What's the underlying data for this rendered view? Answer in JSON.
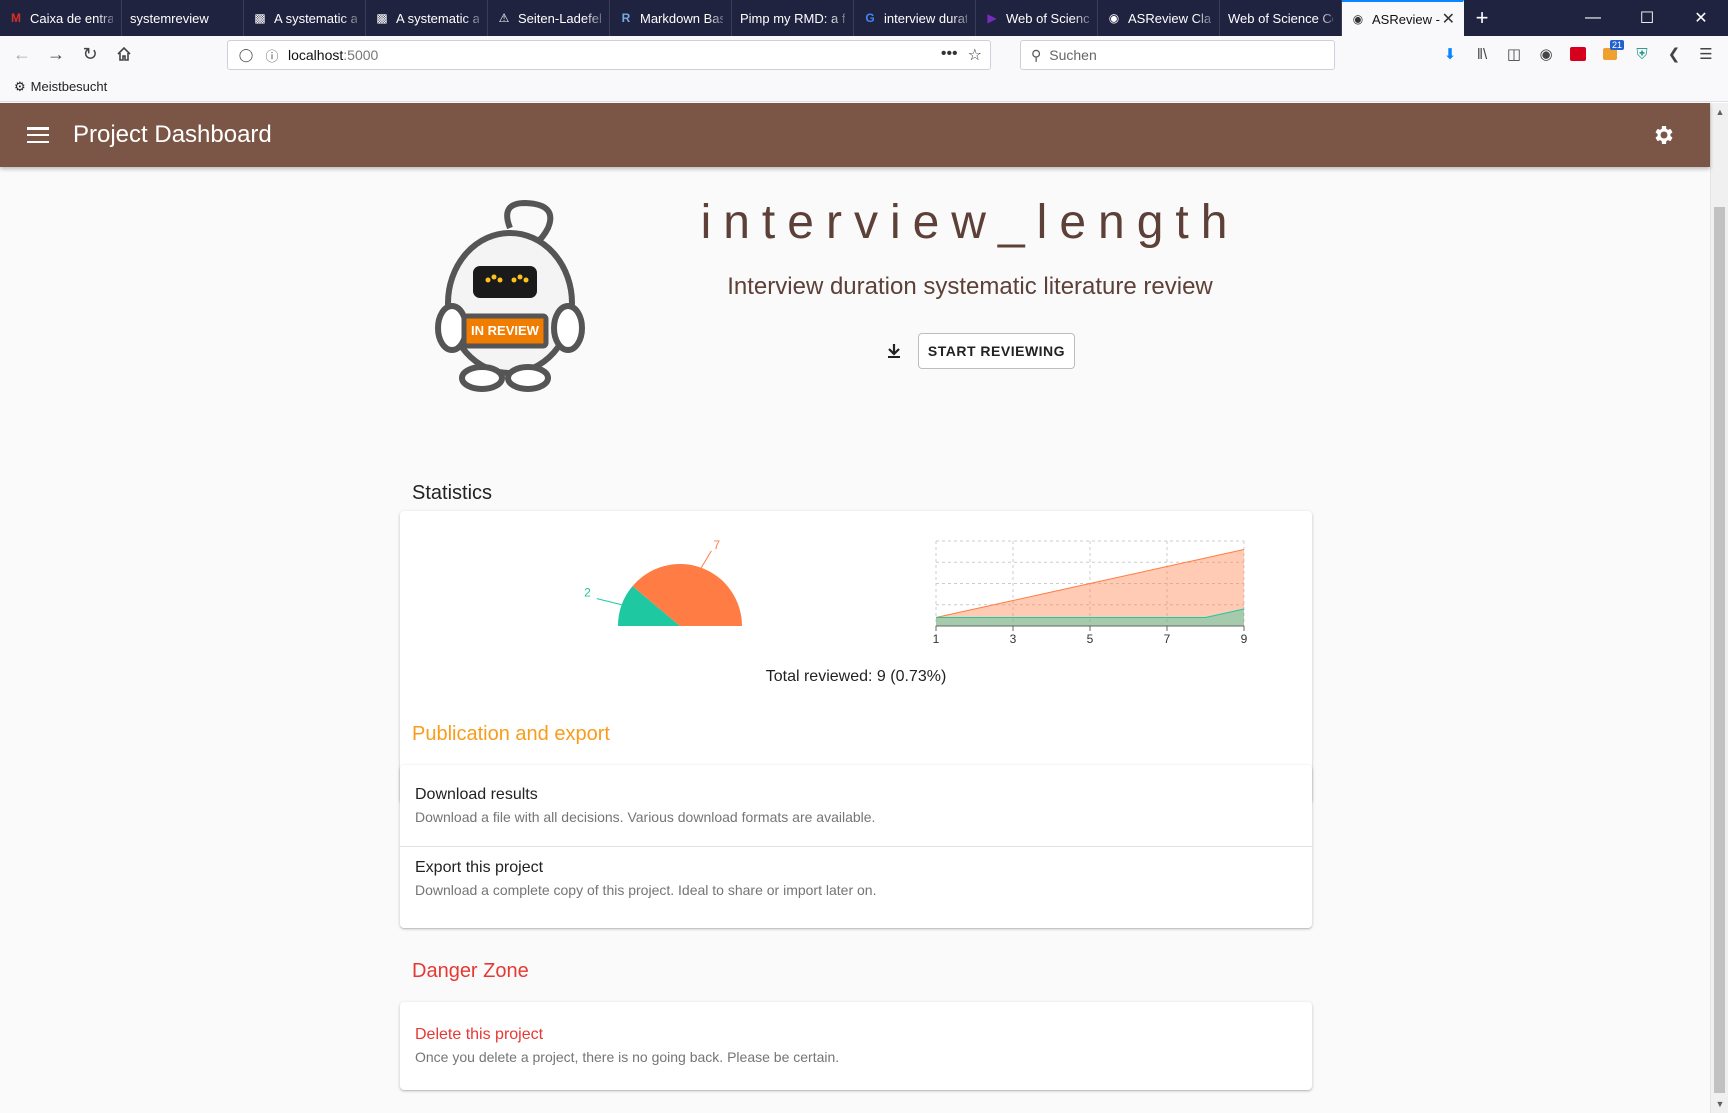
{
  "browser": {
    "tabs": [
      {
        "label": "Caixa de entrada",
        "icon": "gmail-icon",
        "icon_color": "#d93025"
      },
      {
        "label": "systemreview",
        "icon": "",
        "icon_color": ""
      },
      {
        "label": "A systematic approach",
        "icon": "page-icon",
        "icon_color": "#ffffff"
      },
      {
        "label": "A systematic approach",
        "icon": "page-icon",
        "icon_color": "#ffffff"
      },
      {
        "label": "Seiten-Ladefehler",
        "icon": "warning-icon",
        "icon_color": "#ffffff"
      },
      {
        "label": "Markdown Basics",
        "icon": "r-icon",
        "icon_color": "#75aadb"
      },
      {
        "label": "Pimp my RMD: a few tips",
        "icon": "",
        "icon_color": ""
      },
      {
        "label": "interview duration",
        "icon": "google-icon",
        "icon_color": "#4285f4"
      },
      {
        "label": "Web of Science",
        "icon": "play-icon",
        "icon_color": "#7b2cbf"
      },
      {
        "label": "ASReview Class",
        "icon": "asreview-icon",
        "icon_color": "#ffffff"
      },
      {
        "label": "Web of Science Core",
        "icon": "",
        "icon_color": ""
      },
      {
        "label": "ASReview -",
        "icon": "asreview-icon",
        "icon_color": "#333333",
        "active": true
      }
    ],
    "new_tab": "+",
    "url_host": "localhost",
    "url_port": ":5000",
    "search_placeholder": "Suchen",
    "bookmark_label": "Meistbesucht",
    "badge_count": "21"
  },
  "app": {
    "title": "Project Dashboard",
    "accent_color": "#7b5646"
  },
  "project": {
    "name": "interview_length",
    "description": "Interview duration systematic literature review",
    "status_badge": "IN REVIEW",
    "start_button": "START REVIEWING"
  },
  "statistics": {
    "heading": "Statistics",
    "total_reviewed_text": "Total reviewed: 9 (0.73%)"
  },
  "chart_data": [
    {
      "type": "pie",
      "style": "half-donut",
      "slices": [
        {
          "label": "2",
          "value": 2,
          "color": "#1ec8a0"
        },
        {
          "label": "7",
          "value": 7,
          "color": "#ff7d45"
        }
      ]
    },
    {
      "type": "area",
      "x": [
        1,
        2,
        3,
        4,
        5,
        6,
        7,
        8,
        9
      ],
      "x_ticks": [
        "1",
        "3",
        "5",
        "7",
        "9"
      ],
      "series": [
        {
          "values": [
            1,
            2,
            3,
            4,
            5,
            6,
            7,
            8,
            9
          ],
          "color": "#ff7d45"
        },
        {
          "values": [
            1,
            1,
            1,
            1,
            1,
            1,
            1,
            1,
            2
          ],
          "color": "#1ec8a0"
        }
      ],
      "ylim": [
        0,
        10
      ],
      "grid": true
    }
  ],
  "publication": {
    "heading": "Publication and export",
    "heading_color": "#f89c1c",
    "items": [
      {
        "title": "Download results",
        "subtitle": "Download a file with all decisions. Various download formats are available."
      },
      {
        "title": "Export this project",
        "subtitle": "Download a complete copy of this project. Ideal to share or import later on."
      }
    ]
  },
  "danger": {
    "heading": "Danger Zone",
    "heading_color": "#e53935",
    "items": [
      {
        "title": "Delete this project",
        "subtitle": "Once you delete a project, there is no going back. Please be certain."
      }
    ]
  }
}
